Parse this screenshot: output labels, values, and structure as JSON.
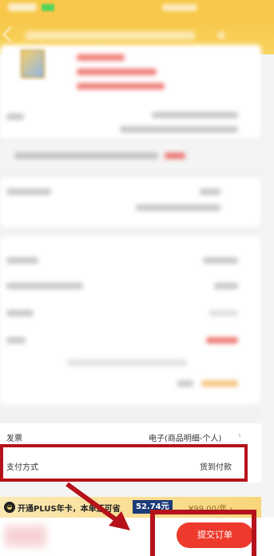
{
  "invoice": {
    "label": "发票",
    "value": "电子(商品明细-个人)",
    "chevron": "›"
  },
  "payment": {
    "label": "支付方式",
    "value": "货到付款"
  },
  "plus_promo": {
    "icon": "plus-icon",
    "text": "开通PLUS年卡，本单还可省",
    "save_amount": "52.74元",
    "price": "¥99.00/年 ›"
  },
  "submit": {
    "label": "提交订单"
  },
  "colors": {
    "header": "#f7c84a",
    "submit": "#ed3a2c",
    "highlight": "#b5121b"
  }
}
